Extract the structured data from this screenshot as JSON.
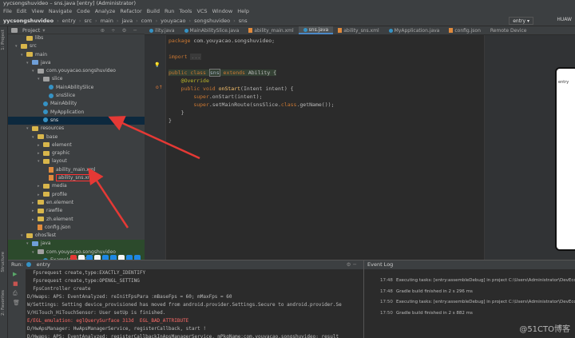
{
  "window": {
    "title": "yycsongshuvideo – sns.java [entry] (Administrator)"
  },
  "menu": [
    "File",
    "Edit",
    "View",
    "Navigate",
    "Code",
    "Analyze",
    "Refactor",
    "Build",
    "Run",
    "Tools",
    "VCS",
    "Window",
    "Help"
  ],
  "breadcrumbs": [
    "yycsongshuvideo",
    "entry",
    "src",
    "main",
    "java",
    "com",
    "youyacao",
    "songshuvideo",
    "sns"
  ],
  "run_config": "entry",
  "device_label": "HUAW",
  "project_panel": {
    "title": "Project"
  },
  "left_strip": [
    "1: Project",
    "Structure",
    "2: Favorites"
  ],
  "tree": [
    {
      "label": "libs",
      "indent": 2,
      "icon": "folder"
    },
    {
      "label": "src",
      "indent": 1,
      "icon": "folder",
      "arrow": "▾"
    },
    {
      "label": "main",
      "indent": 2,
      "icon": "folder",
      "arrow": "▾"
    },
    {
      "label": "java",
      "indent": 3,
      "icon": "folder-blue",
      "arrow": "▾"
    },
    {
      "label": "com.youyacao.songshuvideo",
      "indent": 4,
      "icon": "folder-gray",
      "arrow": "▾"
    },
    {
      "label": "slice",
      "indent": 5,
      "icon": "folder-gray",
      "arrow": "▾"
    },
    {
      "label": "MainAbilitySlice",
      "indent": 6,
      "icon": "class"
    },
    {
      "label": "snsSlice",
      "indent": 6,
      "icon": "class"
    },
    {
      "label": "MainAbility",
      "indent": 5,
      "icon": "class"
    },
    {
      "label": "MyApplication",
      "indent": 5,
      "icon": "class"
    },
    {
      "label": "sns",
      "indent": 5,
      "icon": "class",
      "selected": true
    },
    {
      "label": "resources",
      "indent": 3,
      "icon": "folder",
      "arrow": "▾"
    },
    {
      "label": "base",
      "indent": 4,
      "icon": "folder",
      "arrow": "▾"
    },
    {
      "label": "element",
      "indent": 5,
      "icon": "folder",
      "arrow": "▸"
    },
    {
      "label": "graphic",
      "indent": 5,
      "icon": "folder",
      "arrow": "▸"
    },
    {
      "label": "layout",
      "indent": 5,
      "icon": "folder",
      "arrow": "▾"
    },
    {
      "label": "ability_main.xml",
      "indent": 6,
      "icon": "xml"
    },
    {
      "label": "ability_sns.xml",
      "indent": 6,
      "icon": "xml",
      "boxed": true
    },
    {
      "label": "media",
      "indent": 5,
      "icon": "folder",
      "arrow": "▸"
    },
    {
      "label": "profile",
      "indent": 5,
      "icon": "folder",
      "arrow": "▸"
    },
    {
      "label": "en.element",
      "indent": 4,
      "icon": "folder",
      "arrow": "▸"
    },
    {
      "label": "rawfile",
      "indent": 4,
      "icon": "folder",
      "arrow": "▸"
    },
    {
      "label": "zh.element",
      "indent": 4,
      "icon": "folder",
      "arrow": "▸"
    },
    {
      "label": "config.json",
      "indent": 4,
      "icon": "json"
    },
    {
      "label": "ohosTest",
      "indent": 2,
      "icon": "folder",
      "arrow": "▾"
    },
    {
      "label": "java",
      "indent": 3,
      "icon": "folder-blue",
      "arrow": "▾",
      "green": true
    },
    {
      "label": "com.youyacao.songshuvideo",
      "indent": 4,
      "icon": "folder-gray",
      "arrow": "▾",
      "green": true
    },
    {
      "label": "ExampleOhosTest",
      "indent": 5,
      "icon": "class",
      "green": true
    },
    {
      "label": "test",
      "indent": 2,
      "icon": "folder",
      "arrow": "▸"
    }
  ],
  "tabs": [
    {
      "label": "ility.java"
    },
    {
      "label": "MainAbilitySlice.java"
    },
    {
      "label": "ability_main.xml"
    },
    {
      "label": "sns.java",
      "active": true
    },
    {
      "label": "ability_sns.xml"
    },
    {
      "label": "MyApplication.java"
    },
    {
      "label": "config.json"
    },
    {
      "label": "Remote Device"
    }
  ],
  "code": {
    "package_kw": "package",
    "package_name": " com.youyacao.songshuvideo;",
    "import_kw": "import",
    "import_fold": "...",
    "class_line": {
      "kw1": "public class ",
      "name": "sns",
      "kw2": " extends ",
      "rest": "Ability {"
    },
    "override": "@Override",
    "method_line": {
      "kw": "public void ",
      "fn": "onStart",
      "rest": "(Intent intent) {"
    },
    "super_call": {
      "kw": "super",
      "rest": ".onStart(intent);"
    },
    "route_call": {
      "kw": "super",
      "rest1": ".setMainRoute(snsSlice.",
      "kw2": "class",
      "rest2": ".getName());"
    },
    "close1": "}",
    "close2": "}"
  },
  "run_panel": {
    "label": "Run:",
    "config": "entry"
  },
  "log_lines": [
    {
      "text": "  Fpsrequest create,type:EXACTLY_IDENTIFY",
      "err": false
    },
    {
      "text": "  Fpsrequest create,type:OPENGL_SETTING",
      "err": false
    },
    {
      "text": "  FpsController create",
      "err": false
    },
    {
      "text": "D/Hwaps: APS: EventAnalyzed: reInitFpsPara :mBaseFps = 60; mMaxFps = 60",
      "err": false
    },
    {
      "text": "W/Settings: Setting device_provisioned has moved from android.provider.Settings.Secure to android.provider.Se",
      "err": false
    },
    {
      "text": "V/HiTouch_HiTouchSensor: User setUp is finished.",
      "err": false
    },
    {
      "text": "E/EGL_emulation: eglQuerySurface 313d  EGL_BAD_ATTRIBUTE",
      "err": true
    },
    {
      "text": "D/HwApsManager: HwApsManagerService, registerCallback, start !",
      "err": false
    },
    {
      "text": "D/Hwaps: APS: EventAnalyzed: registerCallbackInApsManagerService, mPkgName:com.youyacao.songshuvideo; result",
      "err": false
    }
  ],
  "event_log": {
    "title": "Event Log",
    "events": [
      {
        "time": "17:48",
        "text": "Executing tasks: [entry:assembleDebug] in project C:\\Users\\Administrator\\DevEco"
      },
      {
        "time": "17:48",
        "text": "Gradle build finished in 2 s 296 ms"
      },
      {
        "time": "17:50",
        "text": "Executing tasks: [entry:assembleDebug] in project C:\\Users\\Administrator\\DevEco"
      },
      {
        "time": "17:50",
        "text": "Gradle build finished in 2 s 882 ms"
      }
    ]
  },
  "preview_text": "entry",
  "watermark": "@51CTO博客",
  "colors": {
    "arrow": "#e53935",
    "selection": "#0d293e",
    "accent": "#4a88c7"
  }
}
